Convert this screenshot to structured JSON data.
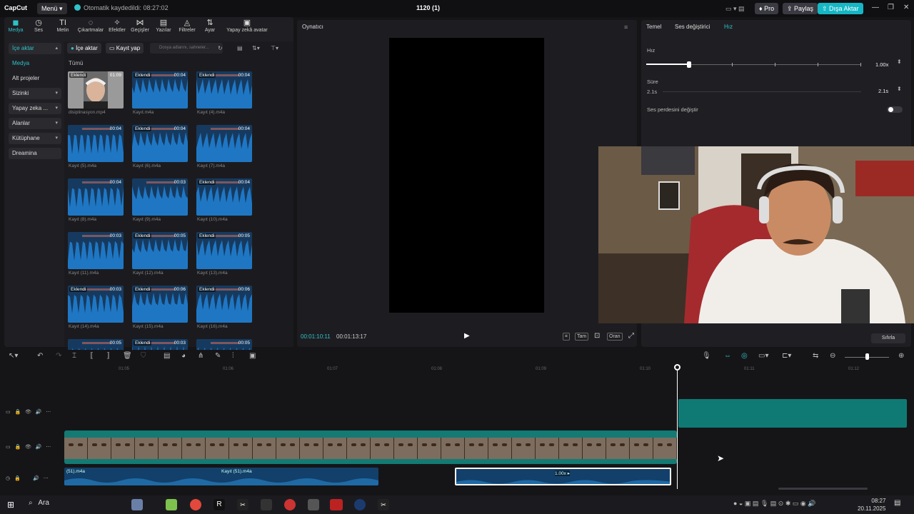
{
  "titlebar": {
    "logo": "CapCut",
    "menu_label": "Menü",
    "autosave": "Otomatik kaydedildi: 08:27:02",
    "project_title": "1120 (1)",
    "pro_label": "Pro",
    "share_label": "Paylaş",
    "export_label": "Dışa Aktar",
    "accent": "#2fc2c9"
  },
  "tabs": [
    {
      "label": "Medya",
      "icon": "◼"
    },
    {
      "label": "Ses",
      "icon": "◷"
    },
    {
      "label": "Metin",
      "icon": "TI"
    },
    {
      "label": "Çıkartmalar",
      "icon": "◌"
    },
    {
      "label": "Efektler",
      "icon": "✧"
    },
    {
      "label": "Geçişler",
      "icon": "⋈"
    },
    {
      "label": "Yazılar",
      "icon": "▤"
    },
    {
      "label": "Filtreler",
      "icon": "◬"
    },
    {
      "label": "Ayar",
      "icon": "⇅"
    },
    {
      "label": "Yapay zekâ avatar",
      "icon": "▣"
    }
  ],
  "sidenav": [
    {
      "label": "İçe aktar",
      "chev": "▴"
    },
    {
      "label": "Medya",
      "chev": ""
    },
    {
      "label": "Alt projeler",
      "chev": ""
    },
    {
      "label": "Sizinki",
      "chev": "▾"
    },
    {
      "label": "Yapay zeka ...",
      "chev": "▾"
    },
    {
      "label": "Alanlar",
      "chev": "▾"
    },
    {
      "label": "Kütüphane",
      "chev": "▾"
    },
    {
      "label": "Dreamina",
      "chev": ""
    }
  ],
  "media": {
    "import_btn": "İçe aktar",
    "record_btn": "Kayıt yap",
    "search_placeholder": "Dosya adlarını, sahneler...",
    "all_label": "Tümü",
    "items": [
      {
        "badge": "Eklendi",
        "dur": "01:09",
        "name": "disiplinasyon.mp4",
        "video": true
      },
      {
        "badge": "Eklendi",
        "dur": "00:04",
        "name": "Kayıt.m4a"
      },
      {
        "badge": "Eklendi",
        "dur": "00:04",
        "name": "Kayıt (4).m4a"
      },
      {
        "badge": "",
        "dur": "00:04",
        "name": "Kayıt (5).m4a"
      },
      {
        "badge": "Eklendi",
        "dur": "00:04",
        "name": "Kayıt (6).m4a"
      },
      {
        "badge": "",
        "dur": "00:04",
        "name": "Kayıt (7).m4a"
      },
      {
        "badge": "",
        "dur": "00:04",
        "name": "Kayıt (8).m4a"
      },
      {
        "badge": "",
        "dur": "00:03",
        "name": "Kayıt (9).m4a"
      },
      {
        "badge": "Eklendi",
        "dur": "00:04",
        "name": "Kayıt (10).m4a"
      },
      {
        "badge": "",
        "dur": "00:03",
        "name": "Kayıt (11).m4a"
      },
      {
        "badge": "Eklendi",
        "dur": "00:05",
        "name": "Kayıt (12).m4a"
      },
      {
        "badge": "Eklendi",
        "dur": "00:05",
        "name": "Kayıt (13).m4a"
      },
      {
        "badge": "Eklendi",
        "dur": "00:03",
        "name": "Kayıt (14).m4a"
      },
      {
        "badge": "Eklendi",
        "dur": "00:06",
        "name": "Kayıt (15).m4a"
      },
      {
        "badge": "Eklendi",
        "dur": "00:06",
        "name": "Kayıt (16).m4a"
      },
      {
        "badge": "",
        "dur": "00:05",
        "name": ""
      },
      {
        "badge": "Eklendi",
        "dur": "00:03",
        "name": ""
      },
      {
        "badge": "",
        "dur": "00:05",
        "name": ""
      }
    ]
  },
  "player": {
    "title": "Oynatıcı",
    "time_current": "00:01:10:11",
    "time_total": "00:01:13:17",
    "full_label": "Tam",
    "ratio_label": "Oran"
  },
  "rightpanel": {
    "tabs": [
      "Temel",
      "Ses değiştirici",
      "Hız"
    ],
    "speed_label": "Hız",
    "speed_value": "1.00x",
    "speed_level": 0.2,
    "duration_label": "Süre",
    "duration_left": "2.1s",
    "duration_value": "2.1s",
    "pitch_label": "Ses perdesini değiştir",
    "reset_label": "Sıfırla"
  },
  "timeline": {
    "ticks": [
      "01:05",
      "01:06",
      "01:07",
      "01:08",
      "01:09",
      "01:10",
      "01:11",
      "01:12"
    ],
    "audio_clip1": "(51).m4a",
    "audio_clip2": "Kayıt (51).m4a",
    "audio_clip3_speed": "1.00x ▸"
  },
  "taskbar": {
    "search": "Ara",
    "time": "08:27",
    "date": "20.11.2025"
  }
}
